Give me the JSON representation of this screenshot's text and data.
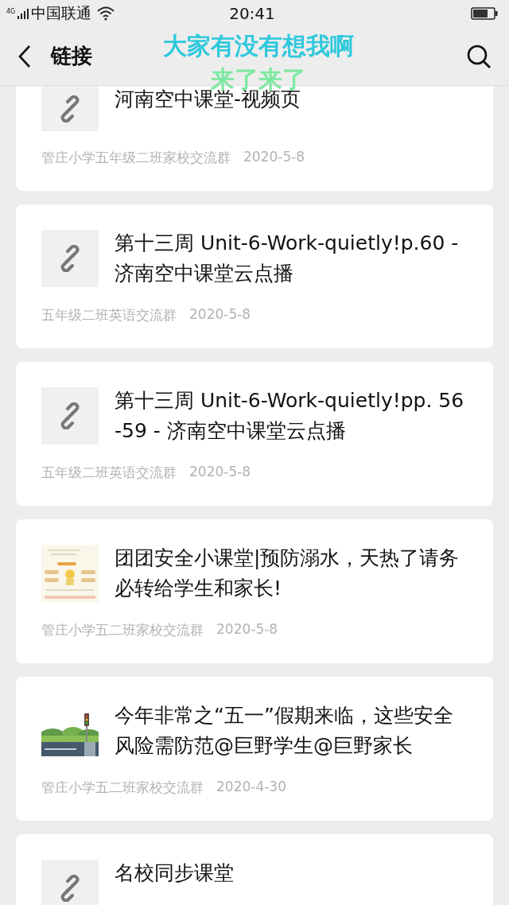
{
  "status_bar": {
    "network": "4G",
    "carrier": "中国联通",
    "time": "20:41"
  },
  "header": {
    "title": "链接"
  },
  "overlay_comments": [
    {
      "text": "大家有没有想我啊",
      "color": "#2ec8dc"
    },
    {
      "text": "来了来了",
      "color": "#7de8a0"
    }
  ],
  "cards": [
    {
      "kind": "link",
      "title": "河南空中课堂-视频页",
      "source": "管庄小学五年级二班家校交流群",
      "date": "2020-5-8"
    },
    {
      "kind": "link",
      "title": "第十三周 Unit-6-Work-quietly!p.60 - 济南空中课堂云点播",
      "source": "五年级二班英语交流群",
      "date": "2020-5-8"
    },
    {
      "kind": "link",
      "title": "第十三周 Unit-6-Work-quietly!pp. 56-59 - 济南空中课堂云点播",
      "source": "五年级二班英语交流群",
      "date": "2020-5-8"
    },
    {
      "kind": "picture",
      "title": "团团安全小课堂|预防溺水，天热了请务必转给学生和家长!",
      "source": "管庄小学五二班家校交流群",
      "date": "2020-5-8"
    },
    {
      "kind": "picture",
      "title": "今年非常之“五一”假期来临，这些安全风险需防范@巨野学生@巨野家长",
      "source": "管庄小学五二班家校交流群",
      "date": "2020-4-30"
    },
    {
      "kind": "link",
      "title": "名校同步课堂"
    }
  ]
}
